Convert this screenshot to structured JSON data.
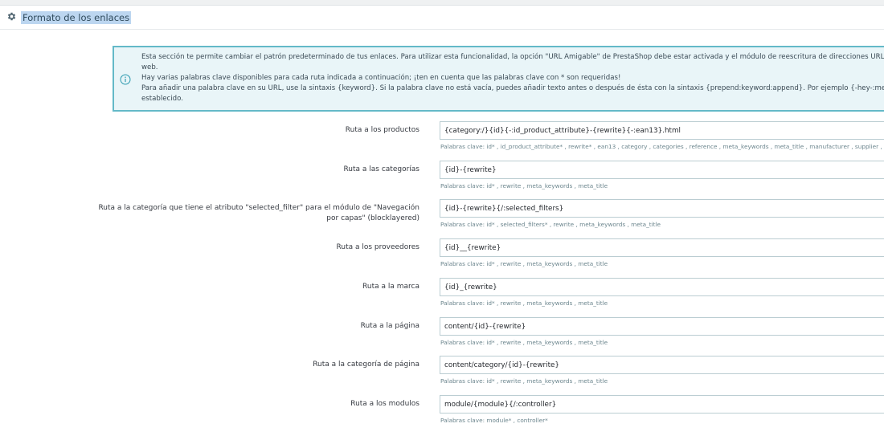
{
  "panel": {
    "title": "Formato de los enlaces",
    "icon": "gear-icon"
  },
  "alert": {
    "icon": "info-circle-icon",
    "color": "#64b9c8",
    "lines": [
      "Esta sección te permite cambiar el patrón predeterminado de tus enlaces. Para utilizar esta funcionalidad, la opción \"URL Amigable\" de PrestaShop debe estar activada y el módulo de reescritura de direcciones URL de Apache",
      "web.",
      "Hay varias palabras clave disponibles para cada ruta indicada a continuación; ¡ten en cuenta que las palabras clave con * son requeridas!",
      "Para añadir una palabra clave en su URL, use la sintaxis {keyword}. Si la palabra clave no está vacía, puedes añadir texto antes o después de ésta con la sintaxis {prepend:keyword:append}. Por ejemplo {-hey-:meta_title} añadirá",
      "establecido."
    ]
  },
  "routes": [
    {
      "label": "Ruta a los productos",
      "value": "{category:/}{id}{-:id_product_attribute}-{rewrite}{-:ean13}.html",
      "help": "Palabras clave: id* , id_product_attribute* , rewrite* , ean13 , category , categories , reference , meta_keywords , meta_title , manufacturer , supplier , price , tags"
    },
    {
      "label": "Ruta a las categorías",
      "value": "{id}-{rewrite}",
      "help": "Palabras clave: id* , rewrite , meta_keywords , meta_title"
    },
    {
      "label": "Ruta a la categoría que tiene el atributo \"selected_filter\" para el módulo de \"Navegación por capas\" (blocklayered)",
      "value": "{id}-{rewrite}{/:selected_filters}",
      "help": "Palabras clave: id* , selected_filters* , rewrite , meta_keywords , meta_title"
    },
    {
      "label": "Ruta a los proveedores",
      "value": "{id}__{rewrite}",
      "help": "Palabras clave: id* , rewrite , meta_keywords , meta_title"
    },
    {
      "label": "Ruta a la marca",
      "value": "{id}_{rewrite}",
      "help": "Palabras clave: id* , rewrite , meta_keywords , meta_title"
    },
    {
      "label": "Ruta a la página",
      "value": "content/{id}-{rewrite}",
      "help": "Palabras clave: id* , rewrite , meta_keywords , meta_title"
    },
    {
      "label": "Ruta a la categoría de página",
      "value": "content/category/{id}-{rewrite}",
      "help": "Palabras clave: id* , rewrite , meta_keywords , meta_title"
    },
    {
      "label": "Ruta a los modulos",
      "value": "module/{module}{/:controller}",
      "help": "Palabras clave: module* , controller*"
    }
  ]
}
